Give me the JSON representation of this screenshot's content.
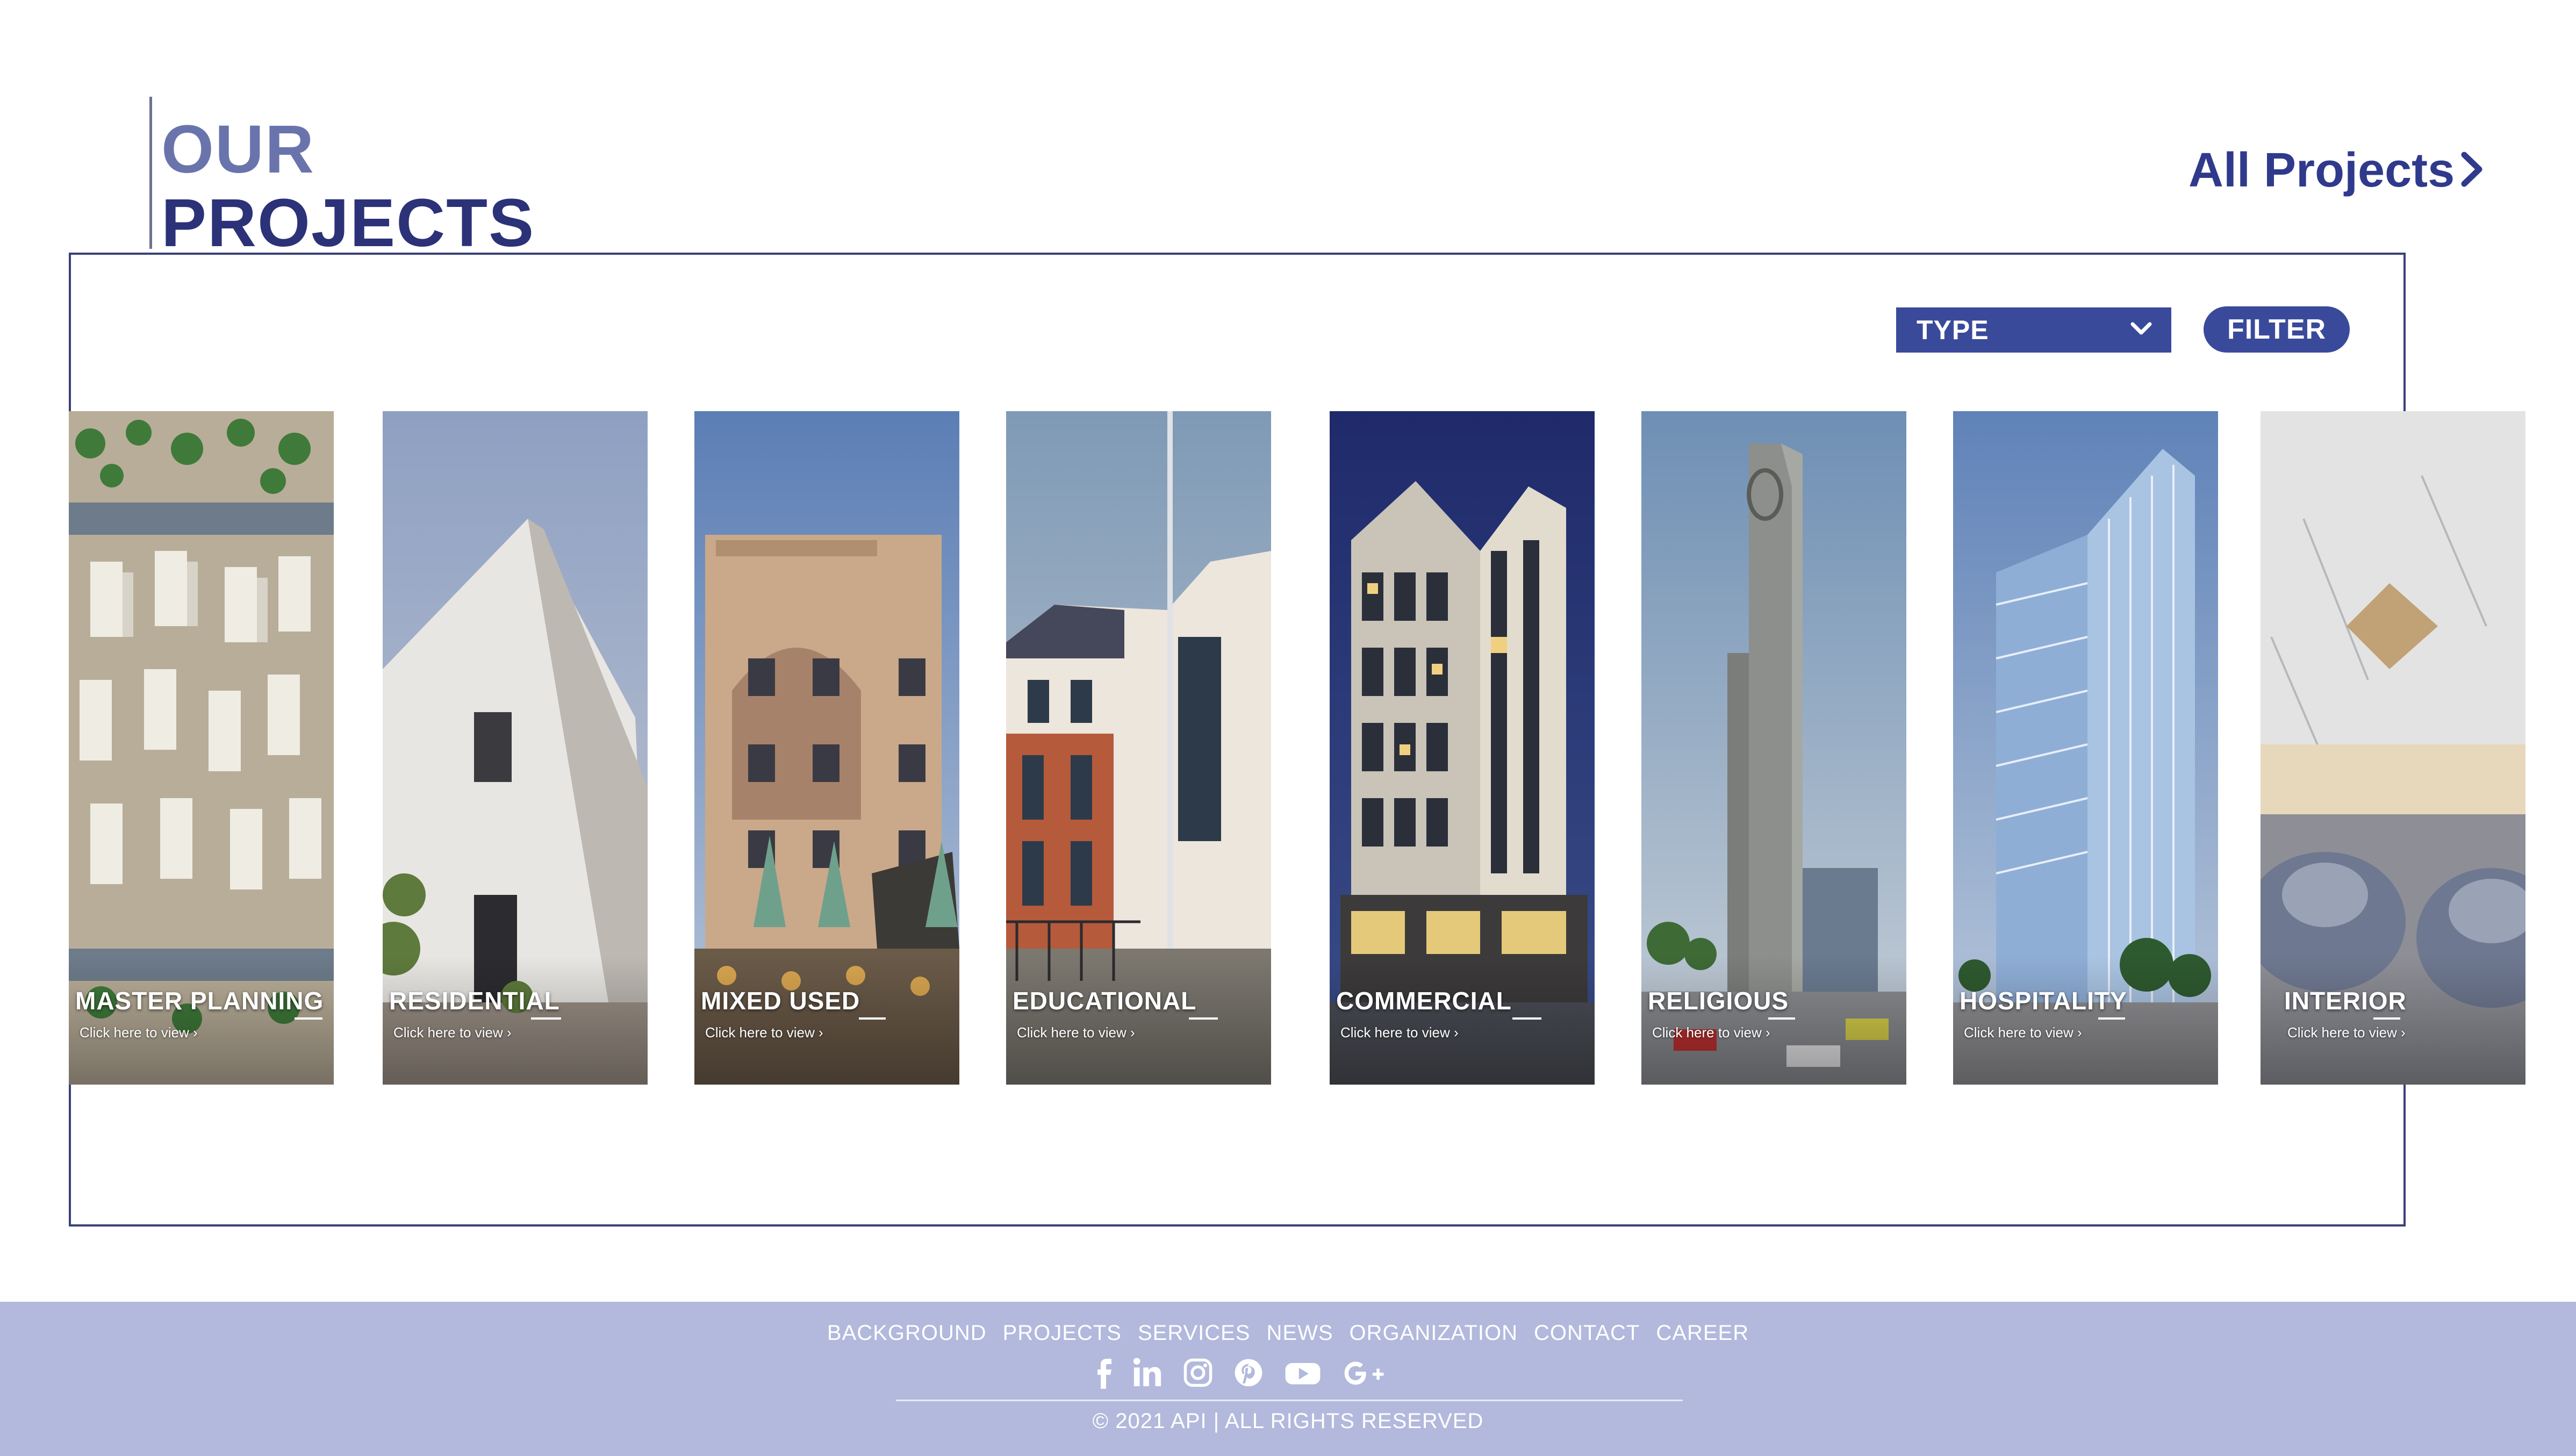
{
  "header": {
    "title_line1": "OUR",
    "title_line2": "PROJECTS",
    "all_projects_label": "All Projects"
  },
  "filters": {
    "type_value": "TYPE",
    "filter_label": "FILTER"
  },
  "cards": [
    {
      "title": "MASTER PLANNING",
      "link": "Click here to view",
      "icon": "aerial-master-plan-image"
    },
    {
      "title": "RESIDENTIAL",
      "link": "Click here to view",
      "icon": "residential-building-image"
    },
    {
      "title": "MIXED USED",
      "link": "Click here to view",
      "icon": "mixed-use-building-image"
    },
    {
      "title": "EDUCATIONAL",
      "link": "Click here to view",
      "icon": "educational-building-image"
    },
    {
      "title": "COMMERCIAL",
      "link": "Click here to view",
      "icon": "commercial-tower-image"
    },
    {
      "title": "RELIGIOUS",
      "link": "Click here to view",
      "icon": "religious-tower-image"
    },
    {
      "title": "HOSPITALITY",
      "link": "Click here to view",
      "icon": "hotel-tower-image"
    },
    {
      "title": "INTERIOR",
      "link": "Click here to view",
      "icon": "interior-lounge-image"
    }
  ],
  "footer": {
    "nav": [
      "BACKGROUND",
      "PROJECTS",
      "SERVICES",
      "NEWS",
      "ORGANIZATION",
      "CONTACT",
      "CAREER"
    ],
    "social_icons": [
      "facebook-icon",
      "linkedin-icon",
      "instagram-icon",
      "pinterest-icon",
      "youtube-icon",
      "google-plus-icon"
    ],
    "copyright": "© 2021 API | ALL RIGHTS RESERVED"
  },
  "colors": {
    "brand_dark": "#2b3278",
    "brand_light": "#6a74ac",
    "button": "#3a4a9b",
    "footer_bg": "#b2b9dc"
  }
}
